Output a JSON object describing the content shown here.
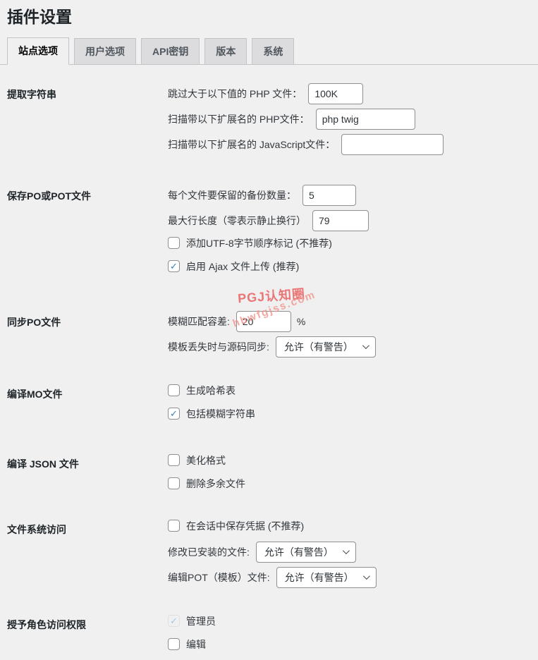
{
  "page": {
    "title": "插件设置"
  },
  "icons": {
    "check": "✓"
  },
  "colors": {
    "page_bg": "#f0f0f1",
    "accent_check": "#3582c4",
    "input_border": "#8c8f94",
    "tab_inactive_bg": "#dcdcde",
    "tab_border": "#c3c4c7",
    "watermark_red": "#ea5757"
  },
  "tabs": [
    {
      "label": "站点选项",
      "active": true
    },
    {
      "label": "用户选项",
      "active": false
    },
    {
      "label": "API密钥",
      "active": false
    },
    {
      "label": "版本",
      "active": false
    },
    {
      "label": "系统",
      "active": false
    }
  ],
  "watermark": {
    "line1": "PGJ认知圈",
    "line2": "hbwfgjss.com"
  },
  "sections": [
    {
      "heading": "提取字符串",
      "items": [
        {
          "type": "input",
          "label": "跳过大于以下值的 PHP 文件：",
          "value": "100K"
        },
        {
          "type": "input",
          "label": "扫描带以下扩展名的 PHP文件：",
          "value": "php twig"
        },
        {
          "type": "input",
          "label": "扫描带以下扩展名的 JavaScript文件：",
          "value": ""
        }
      ]
    },
    {
      "heading": "保存PO或POT文件",
      "items": [
        {
          "type": "input",
          "label": "每个文件要保留的备份数量：",
          "value": "5"
        },
        {
          "type": "input",
          "label": "最大行长度（零表示静止换行）",
          "value": "79"
        },
        {
          "type": "checkbox",
          "label": "添加UTF-8字节顺序标记 (不推荐)",
          "checked": false
        },
        {
          "type": "checkbox",
          "label": "启用 Ajax 文件上传 (推荐)",
          "checked": true
        }
      ]
    },
    {
      "heading": "同步PO文件",
      "items": [
        {
          "type": "input",
          "label": "模糊匹配容差:",
          "value": "20",
          "suffix": "%"
        },
        {
          "type": "select",
          "label": "模板丢失时与源码同步:",
          "value": "允许（有警告）"
        }
      ]
    },
    {
      "heading": "编译MO文件",
      "items": [
        {
          "type": "checkbox",
          "label": "生成哈希表",
          "checked": false
        },
        {
          "type": "checkbox",
          "label": "包括模糊字符串",
          "checked": true
        }
      ]
    },
    {
      "heading": "编译 JSON 文件",
      "items": [
        {
          "type": "checkbox",
          "label": "美化格式",
          "checked": false
        },
        {
          "type": "checkbox",
          "label": "删除多余文件",
          "checked": false
        }
      ]
    },
    {
      "heading": "文件系统访问",
      "items": [
        {
          "type": "checkbox",
          "label": "在会话中保存凭据 (不推荐)",
          "checked": false
        },
        {
          "type": "select",
          "label": "修改已安装的文件:",
          "value": "允许（有警告）"
        },
        {
          "type": "select",
          "label": "编辑POT（模板）文件:",
          "value": "允许（有警告）"
        }
      ]
    },
    {
      "heading": "授予角色访问权限",
      "items": [
        {
          "type": "checkbox",
          "label": "管理员",
          "checked": true,
          "disabled": true
        },
        {
          "type": "checkbox",
          "label": "编辑",
          "checked": false
        }
      ]
    }
  ]
}
